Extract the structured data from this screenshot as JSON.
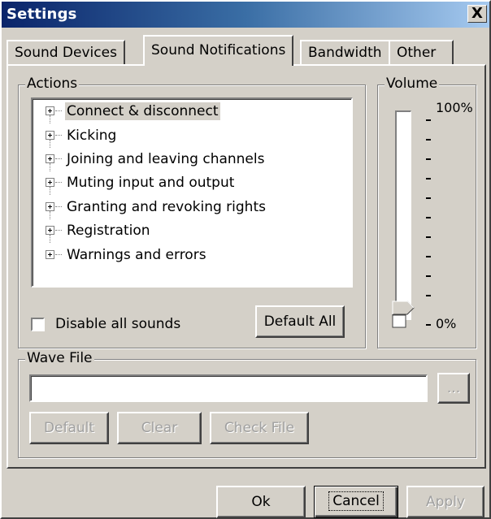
{
  "window": {
    "title": "Settings",
    "close_label": "X"
  },
  "tabs": [
    {
      "label": "Sound Devices",
      "active": false
    },
    {
      "label": "Sound Notifications",
      "active": true
    },
    {
      "label": "Bandwidth",
      "active": false
    },
    {
      "label": "Other",
      "active": false
    }
  ],
  "actions": {
    "group_label": "Actions",
    "items": [
      {
        "label": "Connect & disconnect",
        "selected": true
      },
      {
        "label": "Kicking",
        "selected": false
      },
      {
        "label": "Joining and leaving  channels",
        "selected": false
      },
      {
        "label": "Muting input and output",
        "selected": false
      },
      {
        "label": "Granting and revoking rights",
        "selected": false
      },
      {
        "label": "Registration",
        "selected": false
      },
      {
        "label": "Warnings and errors",
        "selected": false
      }
    ],
    "disable_all_label": "Disable all sounds",
    "disable_all_checked": false,
    "default_all_label": "Default All"
  },
  "volume": {
    "group_label": "Volume",
    "max_label": "100%",
    "min_label": "0%",
    "tick_prefix": "-",
    "level": 0.0
  },
  "wave_file": {
    "group_label": "Wave File",
    "value": "",
    "browse_label": "...",
    "default_label": "Default",
    "clear_label": "Clear",
    "check_file_label": "Check File"
  },
  "footer": {
    "ok_label": "Ok",
    "cancel_label": "Cancel",
    "apply_label": "Apply"
  }
}
